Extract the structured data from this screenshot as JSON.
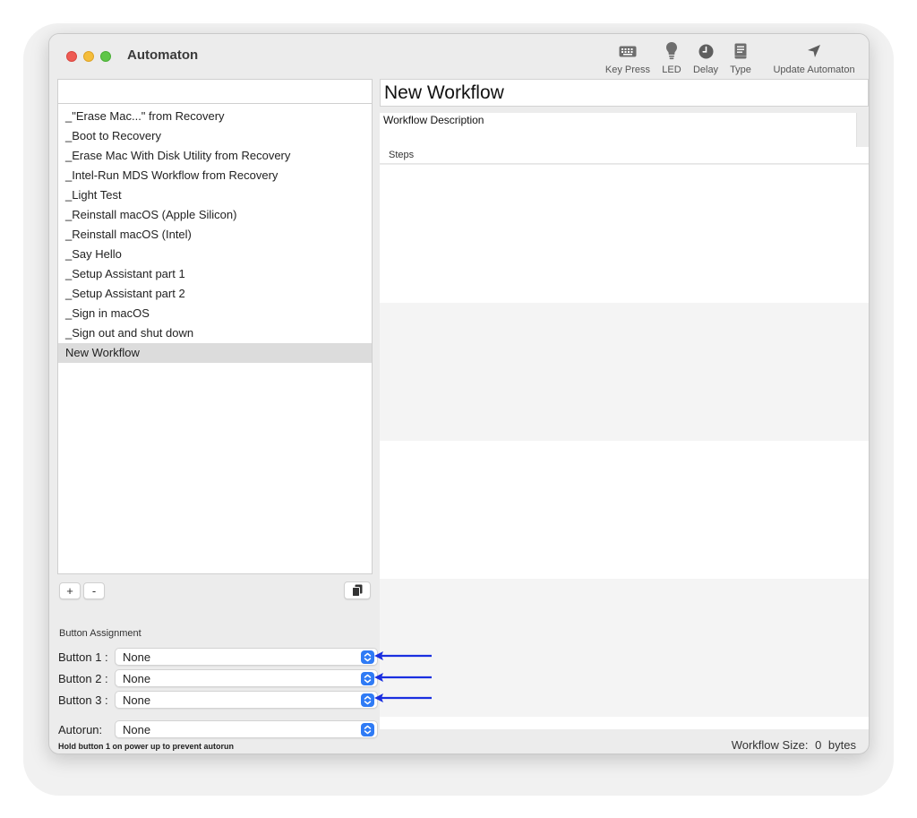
{
  "window": {
    "app_title": "Automaton"
  },
  "toolbar": {
    "items": [
      {
        "label": "Key Press",
        "icon": "keyboard-icon"
      },
      {
        "label": "LED",
        "icon": "lightbulb-icon"
      },
      {
        "label": "Delay",
        "icon": "clock-icon"
      },
      {
        "label": "Type",
        "icon": "document-icon"
      },
      {
        "label": "Update Automaton",
        "icon": "location-arrow-icon"
      }
    ]
  },
  "workflows": {
    "search_value": "",
    "items": [
      "_\"Erase Mac...\" from Recovery",
      "_Boot to Recovery",
      "_Erase Mac With Disk Utility from Recovery",
      "_Intel-Run MDS Workflow from Recovery",
      "_Light Test",
      "_Reinstall macOS (Apple Silicon)",
      "_Reinstall macOS (Intel)",
      "_Say Hello",
      "_Setup Assistant part 1",
      "_Setup Assistant part 2",
      "_Sign in macOS",
      "_Sign out and shut down",
      "New Workflow"
    ],
    "selected_index": 12,
    "add_label": "+",
    "remove_label": "-"
  },
  "assignment": {
    "heading": "Button Assignment",
    "buttons": [
      {
        "label": "Button 1 :",
        "value": "None"
      },
      {
        "label": "Button 2 :",
        "value": "None"
      },
      {
        "label": "Button 3 :",
        "value": "None"
      }
    ],
    "autorun_label": "Autorun:",
    "autorun_value": "None",
    "autorun_note": "Hold button 1 on power up to prevent autorun"
  },
  "detail": {
    "title": "New Workflow",
    "description": "Workflow Description",
    "steps_header": "Steps"
  },
  "status": {
    "size_label": "Workflow Size:",
    "size_value": "0",
    "size_unit": "bytes"
  },
  "colors": {
    "accent": "#2f7bf5",
    "annotation_arrow": "#1a2fe0"
  }
}
